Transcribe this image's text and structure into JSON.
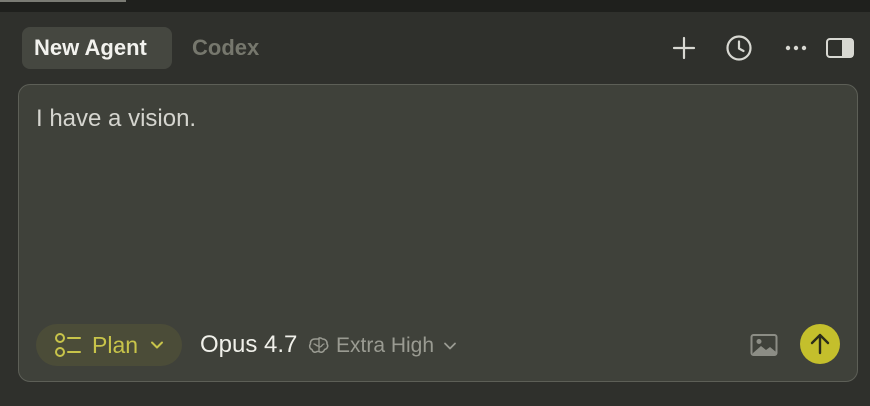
{
  "tabs": [
    {
      "label": "New Agent",
      "active": true
    },
    {
      "label": "Codex",
      "active": false
    }
  ],
  "header_actions": [
    "plus-icon",
    "history-clock-icon",
    "more-horizontal-icon",
    "sidebar-toggle-icon"
  ],
  "composer": {
    "text": "I have a vision."
  },
  "toolbar": {
    "mode_label": "Plan",
    "mode_icon": "plan-list-icon",
    "model_name": "Opus 4.7",
    "effort_icon": "brain-icon",
    "effort_label": "Extra High",
    "image_icon": "image-icon",
    "send_icon": "arrow-up-icon"
  },
  "colors": {
    "background": "#2f302c",
    "composer_bg": "#3f413a",
    "accent": "#c4bf2c",
    "mode_text": "#c8c44a"
  }
}
